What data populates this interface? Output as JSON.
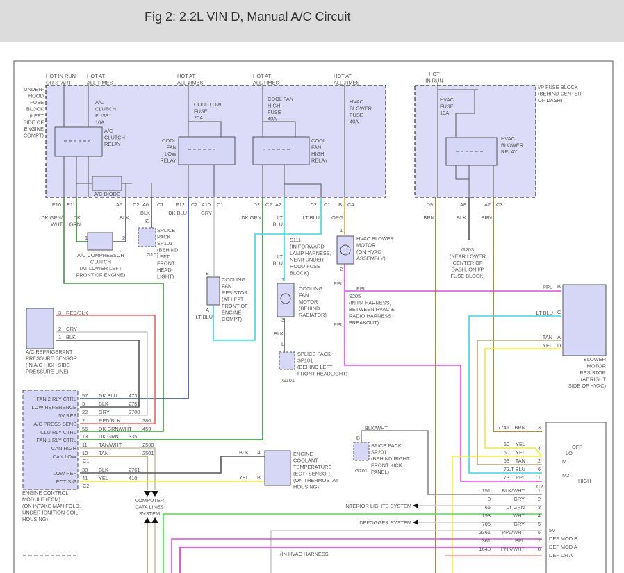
{
  "title": "Fig 2: 2.2L VIN D, Manual A/C Circuit",
  "labels": {
    "hot_run_start": [
      "HOT IN RUN",
      "OR START"
    ],
    "hot1": [
      "HOT AT",
      "ALL TIMES"
    ],
    "hot2": [
      "HOT AT",
      "ALL TIMES"
    ],
    "hot3": [
      "HOT AT",
      "ALL TIMES"
    ],
    "hot4": [
      "HOT AT",
      "ALL TIMES"
    ],
    "uhfb": [
      "UNDER-",
      "HOOD",
      "FUSE",
      "BLOCK",
      "(LEFT",
      "SIDE OF",
      "ENGINE",
      "COMPT)"
    ],
    "ac_clutch_fuse": [
      "A/C",
      "CLUTCH",
      "FUSE",
      "10A"
    ],
    "cool_low_fuse": [
      "COOL LOW",
      "FUSE",
      "20A"
    ],
    "cool_high_fuse": [
      "COOL FAN",
      "HIGH",
      "FUSE",
      "40A"
    ],
    "hvac_blower_fuse": [
      "HVAC",
      "BLOWER",
      "FUSE",
      "40A"
    ],
    "ac_clutch_relay": [
      "A/C",
      "CLUTCH",
      "RELAY"
    ],
    "cool_low_relay": [
      "COOL",
      "FAN",
      "LOW",
      "RELAY"
    ],
    "cool_high_relay": [
      "COOL",
      "FAN",
      "HIGH",
      "RELAY"
    ],
    "ac_diode": [
      "A/C DIODE"
    ],
    "w_e10": [
      "DK GRN/",
      "WHT"
    ],
    "w_e11": [
      "DK",
      "GRN"
    ],
    "w_a6c2": [
      "BLK"
    ],
    "w_a6c1": [
      "BLK"
    ],
    "pin_k": [
      "K"
    ],
    "w_f12": [
      "DK BLU"
    ],
    "w_a10": [
      "GRY"
    ],
    "w_d2": [
      "DK GRN"
    ],
    "w_a2": [
      "LT",
      "BLU"
    ],
    "w_c2c1": [
      "LT BLU"
    ],
    "w_c4": [
      "ORG"
    ],
    "ac_comp_clutch": [
      "A/C COMPRESSOR",
      "CLUTCH",
      "(AT LOWER LEFT",
      "FRONT OF ENGINE)"
    ],
    "clutch_p1": [
      "1"
    ],
    "clutch_p2": [
      "2"
    ],
    "splice101": [
      "SPLICE",
      "PACK",
      "SP101",
      "(BEHIND",
      "LEFT",
      "FRONT",
      "HEAD-",
      "LIGHT)"
    ],
    "g101a": [
      "G101"
    ],
    "s111": [
      "S111",
      "(IN FORWARD",
      "LAMP HARNESS,",
      "NEAR UNDER-",
      "HOOD FUSE",
      "BLOCK)"
    ],
    "w_ltblu2": [
      "LT",
      "BLU"
    ],
    "hvac_blower_motor": [
      "HVAC BLOWER",
      "MOTOR",
      "(ON HVAC",
      "ASSEMBLY)"
    ],
    "hbm_p1": [
      "1"
    ],
    "hbm_p2": [
      "2"
    ],
    "cooling_fan_resistor": [
      "COOLING",
      "FAN",
      "RESISTOR",
      "(AT LEFT",
      "FRONT OF",
      "ENGINE",
      "COMPT)"
    ],
    "cfr_b": [
      "B"
    ],
    "cfr_a": [
      "A"
    ],
    "cfr_ltblu": [
      "LT BLU"
    ],
    "cooling_fan_motor": [
      "COOLING",
      "FAN",
      "MOTOR",
      "(BEHIND",
      "RADIATOR)"
    ],
    "cfm_p1": [
      "1"
    ],
    "cfm_p3": [
      "3"
    ],
    "cfm_blk": [
      "BLK"
    ],
    "cfm_l": [
      "L"
    ],
    "sp101b": [
      "SPLICE PACK",
      "SP101",
      "(BEHIND LEFT",
      "FRONT HEADLIGHT)"
    ],
    "g101b": [
      "G101"
    ],
    "ppl1": [
      "PPL"
    ],
    "ppl2": [
      "PPL"
    ],
    "ppl3": [
      "PPL"
    ],
    "s205": [
      "S205",
      "(IN I/P HARNESS,",
      "BETWEEN HVAC &",
      "RADIO HARNESS",
      "BREAKOUT)"
    ],
    "hot_in_run": [
      "HOT",
      "IN RUN"
    ],
    "ipfb": [
      "I/P FUSE BLOCK",
      "(BEHIND CENTER",
      "OF DASH)"
    ],
    "hvac_fuse": [
      "HVAC",
      "FUSE",
      "10A"
    ],
    "hvac_blower_relay": [
      "HVAC",
      "BLOWER",
      "RELAY"
    ],
    "w_d9": [
      "BRN"
    ],
    "w_a8": [
      "BLK"
    ],
    "w_a7": [
      "BRN"
    ],
    "g203": [
      "G203",
      "(NEAR LOWER",
      "CENTER OF",
      "DASH, ON I/P",
      "FUSE BLOCK)"
    ],
    "bmr_ppl": [
      "PPL"
    ],
    "bmr_b": [
      "B"
    ],
    "bmr_ltblu": [
      "LT BLU"
    ],
    "bmr_c": [
      "C"
    ],
    "bmr_tan": [
      "TAN"
    ],
    "bmr_a": [
      "A"
    ],
    "bmr_yel": [
      "YEL"
    ],
    "bmr_d": [
      "D"
    ],
    "blower_motor_resistor": [
      "BLOWER",
      "MOTOR",
      "RESISTOR",
      "(AT RIGHT",
      "SIDE OF HVAC)"
    ],
    "ps_p3": [
      "3"
    ],
    "ps_c3": [
      "RED/BLK"
    ],
    "ps_p2": [
      "2"
    ],
    "ps_c2": [
      "GRY"
    ],
    "ps_p1": [
      "1"
    ],
    "ps_c1": [
      "BLK"
    ],
    "pressure_sensor": [
      "A/C REFRIGERANT",
      "PRESSURE SENSOR",
      "(IN A/C HIGH SIDE",
      "PRESSURE LINE)"
    ],
    "ecm": [
      "ENGINE CONTROL",
      "MODULE (ECM)",
      "(ON INTAKE MANIFOLD,",
      "UNDER IGNITION COIL",
      "HOUSING)"
    ],
    "ecm_c1": [
      "C1"
    ],
    "ecm_c2": [
      "C2"
    ],
    "ect_blk": [
      "BLK"
    ],
    "ect_a": [
      "A"
    ],
    "ect_yel": [
      "YEL"
    ],
    "ect_b": [
      "B"
    ],
    "ect": [
      "ENGINE",
      "COOLANT",
      "TEMPERATURE",
      "(ECT) SENSOR",
      "(ON THERMOSTAT",
      "HOUSING)"
    ],
    "cdl": [
      "COMPUTER",
      "DATA LINES",
      "SYSTEM"
    ],
    "sp201_w": [
      "BLK/WHT"
    ],
    "sp201_b": [
      "B"
    ],
    "sp201": [
      "SPICE PACK",
      "SP201",
      "(BEHIND RIGHT",
      "FRONT KICK",
      "PANEL)"
    ],
    "g201": [
      "G201"
    ],
    "sw_off": [
      "OFF"
    ],
    "sw_lo": [
      "LO"
    ],
    "sw_m1": [
      "M1"
    ],
    "sw_m2": [
      "M2"
    ],
    "sw_high": [
      "HIGH"
    ],
    "sw_c2": [
      "C2"
    ],
    "interior": [
      "INTERIOR LIGHTS SYSTEM"
    ],
    "defogger": [
      "DEFOGGER SYSTEM"
    ],
    "r5v": [
      "5V"
    ],
    "defb": [
      "DEF MOD B"
    ],
    "defa": [
      "DEF MOD A"
    ],
    "defdr": [
      "DEF DR A"
    ],
    "hvac_harness": [
      "(IN HVAC HARNESS"
    ]
  },
  "connectors": [
    "E10",
    "E11",
    "A6",
    "C2",
    "A6",
    "C1",
    "F12",
    "C2",
    "A10",
    "C1",
    "D2",
    "C2",
    "A2",
    "C2",
    "C1",
    "B",
    "C4",
    "D9",
    "A8",
    "A7",
    "C3"
  ],
  "ecm_rows": [
    {
      "name": "FAN 2 RLY CTRL",
      "pin": "57",
      "color": "DK BLU",
      "circuit": "473"
    },
    {
      "name": "LOW REFERENCE",
      "pin": "3",
      "color": "BLK",
      "circuit": "2751"
    },
    {
      "name": "5V REF",
      "pin": "22",
      "color": "GRY",
      "circuit": "2700"
    },
    {
      "name": "A/C PRESS SENS",
      "pin": "2",
      "color": "RED/BLK",
      "circuit": "380"
    },
    {
      "name": "CLU RLY CTRL",
      "pin": "56",
      "color": "DK GRN/WHT",
      "circuit": "459"
    },
    {
      "name": "FAN 1 RLY CTRL",
      "pin": "13",
      "color": "DK GRN",
      "circuit": "335"
    },
    {
      "name": "CAN HIGH",
      "pin": "11",
      "color": "TAN/WHT",
      "circuit": "2500"
    },
    {
      "name": "CAN LOW",
      "pin": "10",
      "color": "TAN",
      "circuit": "2501"
    },
    {
      "name": "LOW REF",
      "pin": "38",
      "color": "BLK",
      "circuit": "2761"
    },
    {
      "name": "ECT SIG",
      "pin": "41",
      "color": "YEL",
      "circuit": "410"
    }
  ],
  "switch_rows": [
    {
      "circuit": "7741",
      "color": "BRN",
      "pin": "3"
    },
    {
      "circuit": "60",
      "color": "YEL",
      "pin": "4"
    },
    {
      "circuit": "60",
      "color": "YEL",
      "pin": ""
    },
    {
      "circuit": "63",
      "color": "TAN",
      "pin": "2"
    },
    {
      "circuit": "72",
      "color": "LT BLU",
      "pin": "6"
    },
    {
      "circuit": "73",
      "color": "PPL",
      "pin": "1"
    }
  ],
  "lower_rows": [
    {
      "circuit": "151",
      "color": "BLK/WHT",
      "pin": "1"
    },
    {
      "circuit": "8",
      "color": "GRY",
      "pin": "2"
    },
    {
      "circuit": "66",
      "color": "LT GRN",
      "pin": "3"
    },
    {
      "circuit": "193",
      "color": "WHT",
      "pin": "4"
    },
    {
      "circuit": "705",
      "color": "GRY",
      "pin": "5"
    },
    {
      "circuit": "3361",
      "color": "PPL/WHT",
      "pin": "6"
    },
    {
      "circuit": "361",
      "color": "PPL",
      "pin": "7"
    },
    {
      "circuit": "1648",
      "color": "PNK/WHT",
      "pin": "8"
    }
  ]
}
